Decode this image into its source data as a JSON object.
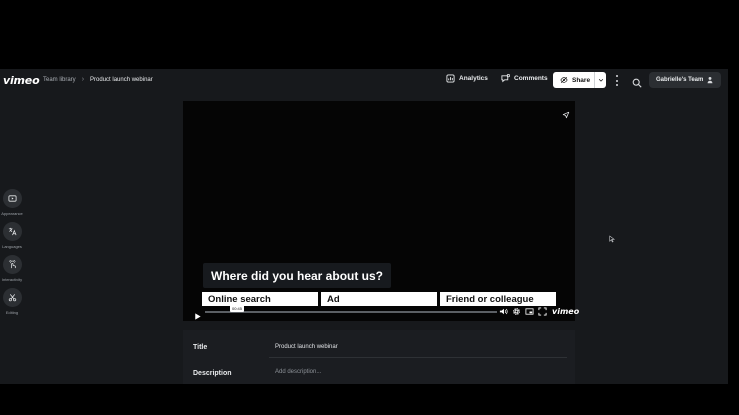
{
  "header": {
    "logo": "vimeo",
    "breadcrumb": [
      "Team library",
      "Product launch webinar"
    ],
    "analytics_label": "Analytics",
    "comments_label": "Comments",
    "share_label": "Share",
    "team_label": "Gabrielle's Team"
  },
  "sidebar": {
    "items": [
      {
        "label": "Appearance",
        "icon": "play-square-icon"
      },
      {
        "label": "Languages",
        "icon": "translate-icon"
      },
      {
        "label": "Interactivity",
        "icon": "hand-pointer-icon"
      },
      {
        "label": "Editing",
        "icon": "scissors-icon"
      }
    ]
  },
  "player": {
    "question": "Where did you hear about us?",
    "answers": [
      "Online search",
      "Ad",
      "Friend or colleague"
    ],
    "time": "00:45",
    "brand": "vimeo"
  },
  "details": {
    "title_label": "Title",
    "title_value": "Product launch webinar",
    "description_label": "Description",
    "description_placeholder": "Add description..."
  },
  "colors": {
    "background": "#17191c",
    "player": "#050505",
    "share_button": "#ffffff",
    "panel": "#1b1d21"
  }
}
